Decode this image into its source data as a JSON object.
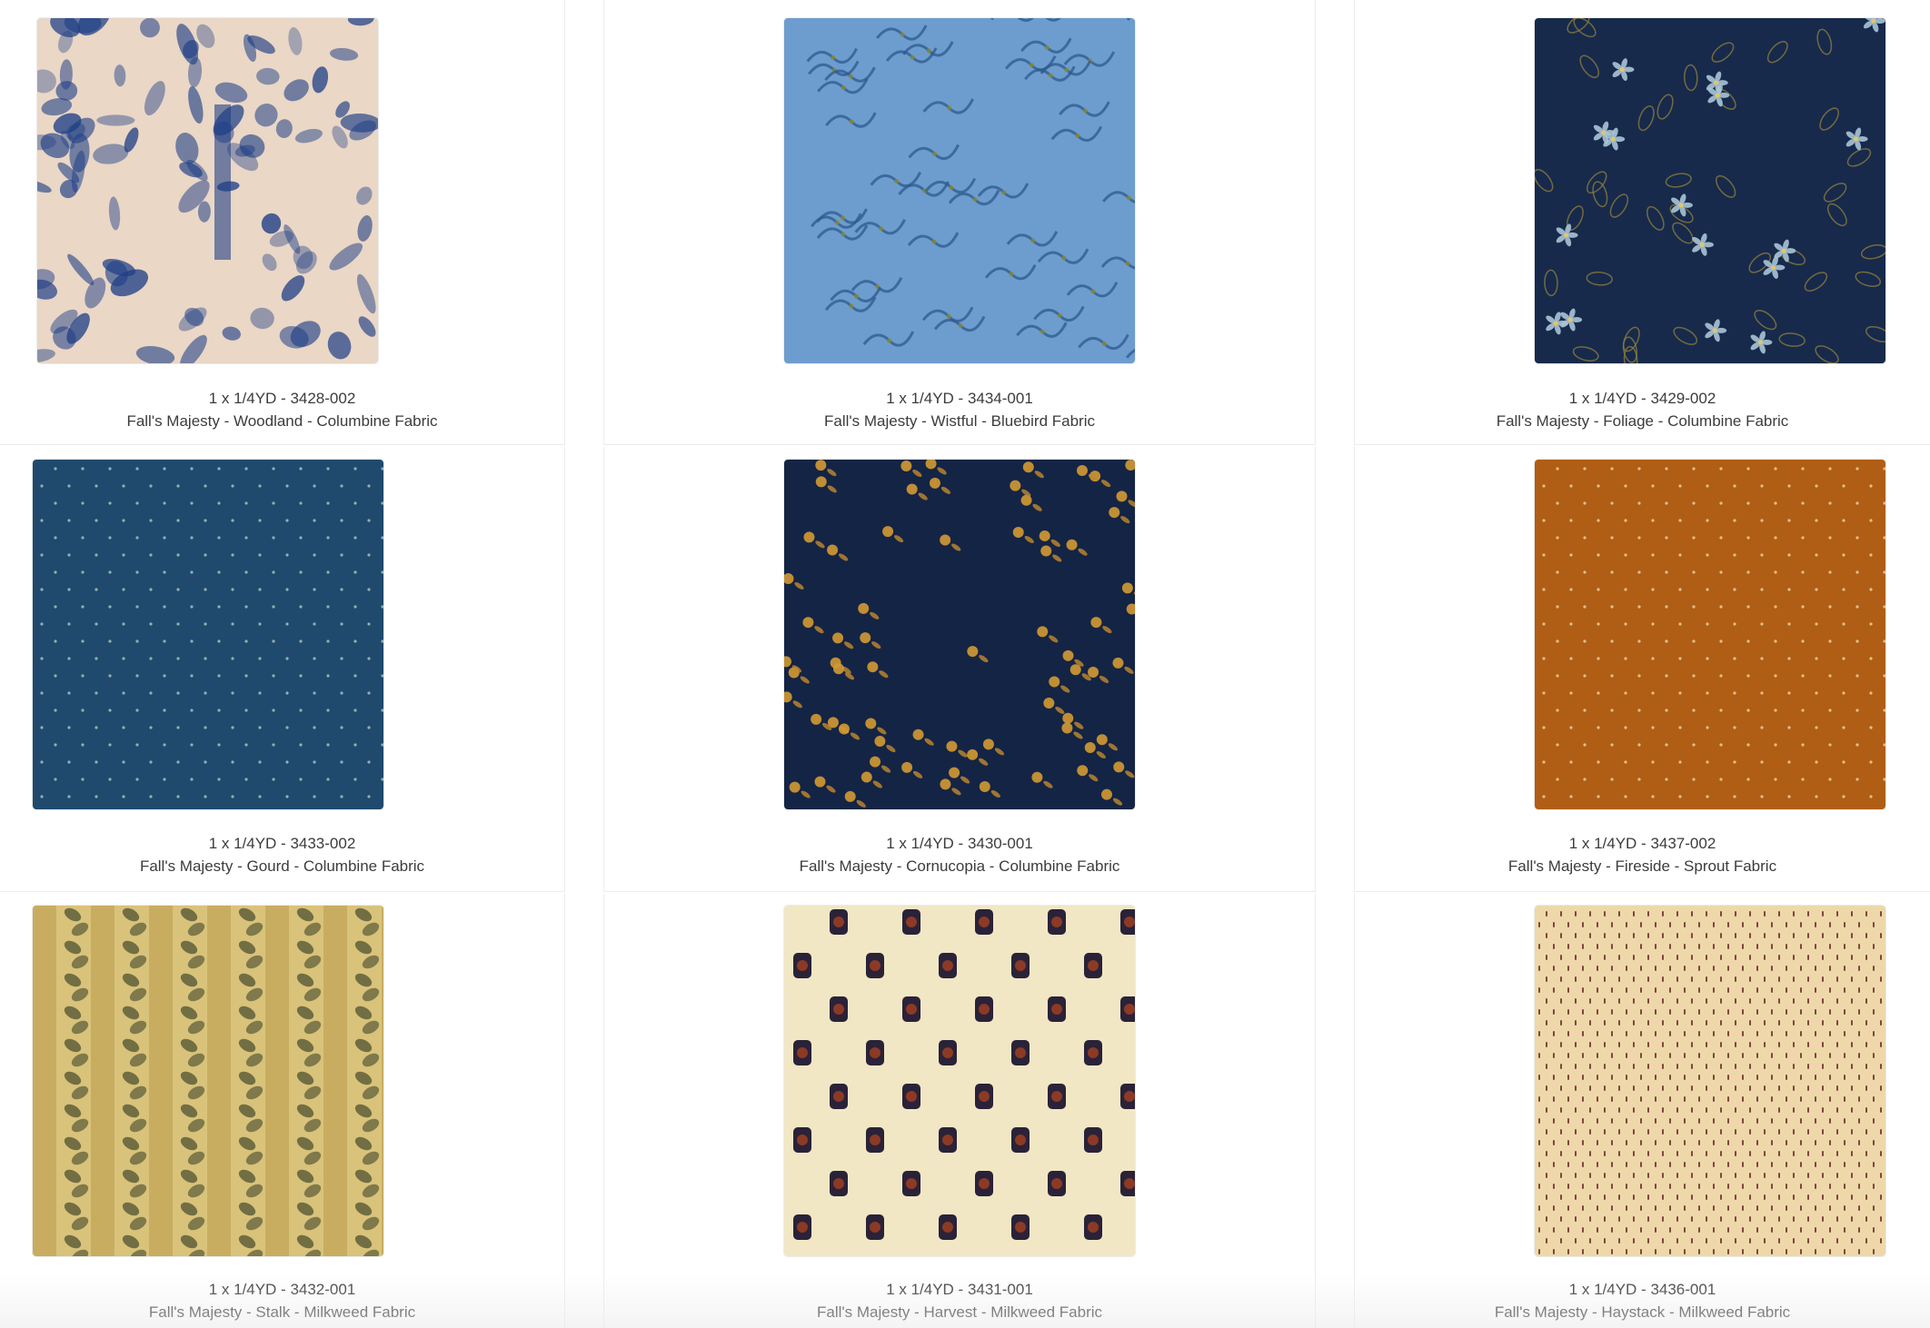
{
  "products": [
    {
      "sku": "1 x 1/4YD - 3428-002",
      "title": "Fall's Majesty - Woodland - Columbine Fabric",
      "swatch_bg": "#ead7c6",
      "swatch_fg": "#1f3f86",
      "pattern": "toile"
    },
    {
      "sku": "1 x 1/4YD - 3434-001",
      "title": "Fall's Majesty - Wistful - Bluebird Fabric",
      "swatch_bg": "#6d9dcf",
      "swatch_fg": "#2d5a8e",
      "pattern": "vine"
    },
    {
      "sku": "1 x 1/4YD - 3429-002",
      "title": "Fall's Majesty - Foliage - Columbine Fabric",
      "swatch_bg": "#172a4c",
      "swatch_fg": "#a9c4d6",
      "pattern": "floral-dark"
    },
    {
      "sku": "1 x 1/4YD - 3433-002",
      "title": "Fall's Majesty - Gourd - Columbine Fabric",
      "swatch_bg": "#1f4a6d",
      "swatch_fg": "#b7c6c0",
      "pattern": "dots"
    },
    {
      "sku": "1 x 1/4YD - 3430-001",
      "title": "Fall's Majesty - Cornucopia - Columbine Fabric",
      "swatch_bg": "#142445",
      "swatch_fg": "#d39a32",
      "pattern": "berries"
    },
    {
      "sku": "1 x 1/4YD - 3437-002",
      "title": "Fall's Majesty - Fireside - Sprout Fabric",
      "swatch_bg": "#b05e16",
      "swatch_fg": "#f3d6a6",
      "pattern": "dots"
    },
    {
      "sku": "1 x 1/4YD - 3432-001",
      "title": "Fall's Majesty - Stalk - Milkweed Fabric",
      "swatch_bg": "#d9c37a",
      "swatch_fg": "#4f5232",
      "pattern": "leaf-stripe"
    },
    {
      "sku": "1 x 1/4YD - 3431-001",
      "title": "Fall's Majesty - Harvest - Milkweed Fabric",
      "swatch_bg": "#f1e7c4",
      "swatch_fg": "#2a2238",
      "pattern": "medallion"
    },
    {
      "sku": "1 x 1/4YD - 3436-001",
      "title": "Fall's Majesty - Haystack - Milkweed Fabric",
      "swatch_bg": "#eed8aa",
      "swatch_fg": "#6b2d2a",
      "pattern": "tiny-dashes"
    }
  ]
}
